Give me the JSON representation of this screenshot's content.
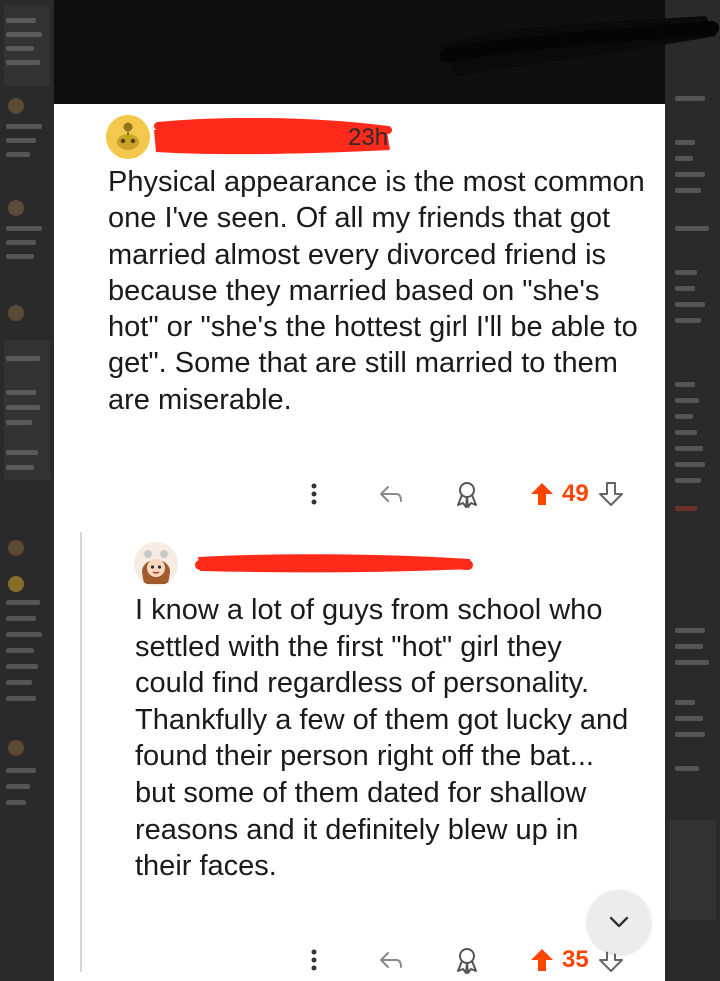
{
  "comments": [
    {
      "time": "23h",
      "body": "Physical appearance is the most common one I've seen. Of all my friends that got married almost every divorced friend is because they married based on \"she's hot\" or \"she's the hottest girl I'll be able to get\". Some that are still married to them are miserable.",
      "votes": "49"
    },
    {
      "body": "I know a lot of guys from school who settled with the first \"hot\" girl they could find regardless of personality. Thankfully a few of them got lucky and found their person right off the bat... but some of them dated for shallow reasons and it definitely blew up in their faces.",
      "votes": "35"
    }
  ],
  "icons": {
    "more": "more-vertical-icon",
    "reply": "reply-icon",
    "award": "award-icon",
    "upvote": "upvote-icon",
    "downvote": "downvote-icon",
    "scroll": "chevron-down-icon"
  },
  "colors": {
    "upvote": "#ff4500",
    "redaction": "#ff2a1a",
    "card": "#ffffff",
    "background": "#1a1a1a"
  }
}
